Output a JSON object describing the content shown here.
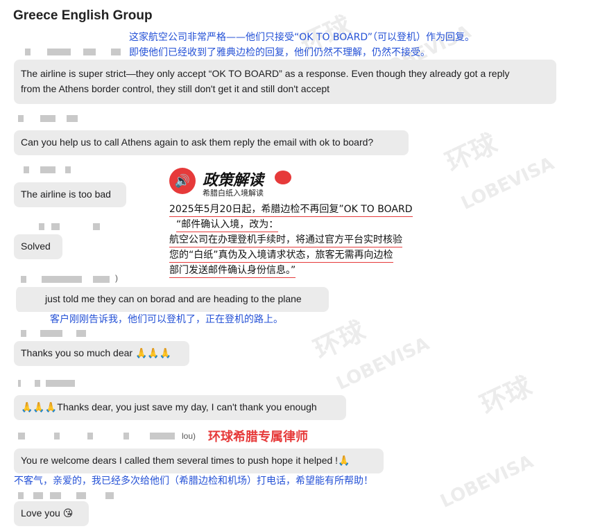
{
  "group_title": "Greece English Group",
  "translations": {
    "t1_line1": "这家航空公司非常严格——他们只接受“OK TO BOARD”（可以登机）作为回复。",
    "t1_line2": "即使他们已经收到了雅典边检的回复，他们仍然不理解，仍然不接受。",
    "t2": "客户刚刚告诉我，他们可以登机了，正在登机的路上。",
    "t3": "不客气，亲爱的，我已经多次给他们（希腊边检和机场）打电话，希望能有所帮助！"
  },
  "messages": {
    "m1_line1": "The airline is super strict—they only accept “OK TO BOARD” as a response. Even though they already got a reply",
    "m1_line2": "from the Athens border control, they still don't get it and still don't accept",
    "m2": "Can you help us to call Athens again to ask them reply the email with ok to board?",
    "m3": "The airline is too bad",
    "m4": "Solved",
    "m5": "just told me they can on borad and are heading to the plane",
    "m6": "Thanks you so much dear 🙏🙏🙏",
    "m7": "🙏🙏🙏Thanks dear, you just save my day, I can't thank you enough",
    "m8": "You re welcome dears I called them several times to push hope it helped !🙏",
    "m9": "Love you 😘"
  },
  "sender_suffixes": {
    "s5": ")",
    "s8": "lou)"
  },
  "policy": {
    "title": "政策解读",
    "subtitle": "希腊白纸入境解读",
    "line1": "2025年5月20日起，希腊边检不再回复”OK TO BOARD",
    "line2": "“邮件确认入境，改为：",
    "line3": "航空公司在办理登机手续时，将通过官方平台实时核验",
    "line4": "您的“白纸”真伪及入境请求状态，旅客无需再向边检",
    "line5": "部门发送邮件确认身份信息。”"
  },
  "lawyer_label": "环球希腊专属律师",
  "watermarks": {
    "cn": "环球",
    "en": "LOBEVISA"
  },
  "colors": {
    "bubble": "#ebebeb",
    "translation_blue": "#2451d6",
    "accent_red": "#e63a3a"
  }
}
